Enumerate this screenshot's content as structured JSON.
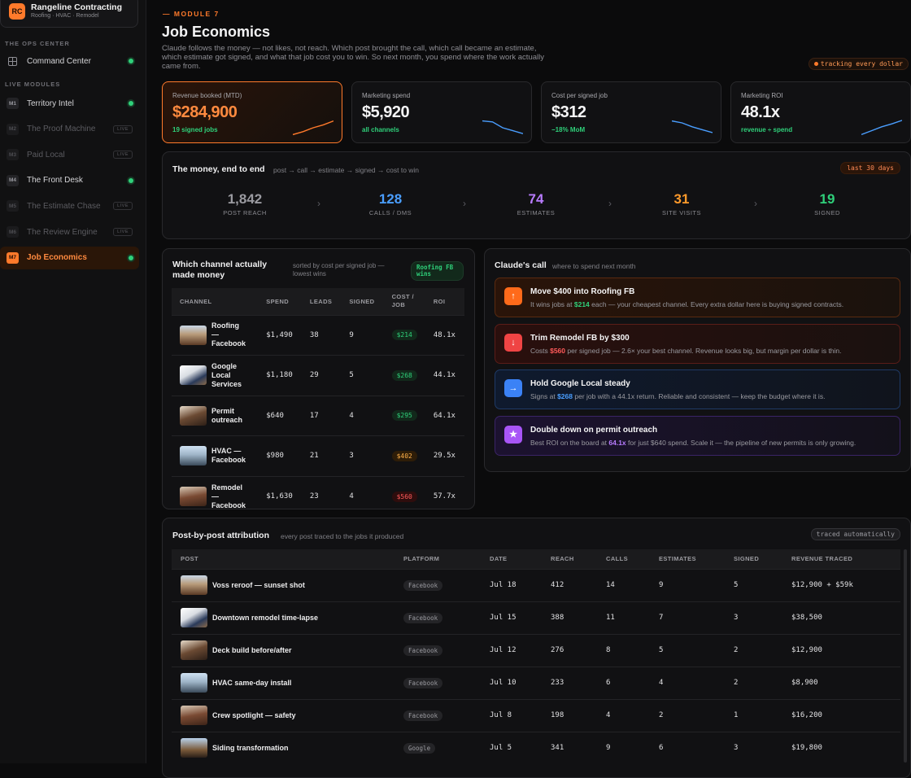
{
  "brand": {
    "badge": "RC",
    "name": "Rangeline Contracting",
    "sub": "Roofing · HVAC · Remodel"
  },
  "sidebar": {
    "ops_label": "THE OPS CENTER",
    "command_center": "Command Center",
    "live_label": "LIVE MODULES",
    "items": [
      {
        "num": "M1",
        "label": "Territory Intel",
        "state": "dot"
      },
      {
        "num": "M2",
        "label": "The Proof Machine",
        "state": "live",
        "tag": "LIVE"
      },
      {
        "num": "M3",
        "label": "Paid Local",
        "state": "live",
        "tag": "LIVE"
      },
      {
        "num": "M4",
        "label": "The Front Desk",
        "state": "dot"
      },
      {
        "num": "M5",
        "label": "The Estimate Chase",
        "state": "live",
        "tag": "LIVE"
      },
      {
        "num": "M6",
        "label": "The Review Engine",
        "state": "live",
        "tag": "LIVE"
      },
      {
        "num": "M7",
        "label": "Job Economics",
        "state": "active"
      }
    ]
  },
  "header": {
    "kicker": "— MODULE 7",
    "title": "Job Economics",
    "lede": "Claude follows the money — not likes, not reach. Which post brought the call, which call became an estimate, which estimate got signed, and what that job cost you to win. So next month, you spend where the work actually came from.",
    "tracking": "tracking every dollar"
  },
  "kpis": [
    {
      "label": "Revenue booked (MTD)",
      "value": "$284,900",
      "sub": "19 signed jobs",
      "trend": [
        0.15,
        0.3,
        0.5,
        0.65,
        0.85
      ],
      "color": "#ff7a2b"
    },
    {
      "label": "Marketing spend",
      "value": "$5,920",
      "sub": "all channels",
      "trend": [
        0.85,
        0.8,
        0.5,
        0.35,
        0.2
      ],
      "color": "#4a9eff"
    },
    {
      "label": "Cost per signed job",
      "value": "$312",
      "sub": "−18% MoM",
      "trend": [
        0.85,
        0.75,
        0.55,
        0.4,
        0.25
      ],
      "color": "#4a9eff"
    },
    {
      "label": "Marketing ROI",
      "value": "48.1x",
      "sub": "revenue ÷ spend",
      "trend": [
        0.15,
        0.35,
        0.55,
        0.7,
        0.88
      ],
      "color": "#4a9eff"
    }
  ],
  "funnel": {
    "title": "The money, end to end",
    "sub": "post → call → estimate → signed → cost to win",
    "range": "last 30 days",
    "steps": [
      {
        "value": "1,842",
        "label": "POST REACH",
        "color": "#9a9aa0"
      },
      {
        "value": "128",
        "label": "CALLS / DMS",
        "color": "#4a9eff"
      },
      {
        "value": "74",
        "label": "ESTIMATES",
        "color": "#b87cff"
      },
      {
        "value": "31",
        "label": "SITE VISITS",
        "color": "#ff9a2b"
      },
      {
        "value": "19",
        "label": "SIGNED",
        "color": "#2fd07a"
      }
    ]
  },
  "channels": {
    "title": "Which channel actually made money",
    "sub": "sorted by cost per signed job — lowest wins",
    "winner": "Roofing FB wins",
    "headers": [
      "CHANNEL",
      "SPEND",
      "LEADS",
      "SIGNED",
      "COST / JOB",
      "ROI"
    ],
    "rows": [
      {
        "name": "Roofing — Facebook",
        "spend": "$1,490",
        "leads": "38",
        "signed": "9",
        "cost": "$214",
        "tone": "g",
        "roi": "48.1x"
      },
      {
        "name": "Google Local Services",
        "spend": "$1,180",
        "leads": "29",
        "signed": "5",
        "cost": "$268",
        "tone": "g",
        "roi": "44.1x"
      },
      {
        "name": "Permit outreach",
        "spend": "$640",
        "leads": "17",
        "signed": "4",
        "cost": "$295",
        "tone": "g",
        "roi": "64.1x"
      },
      {
        "name": "HVAC — Facebook",
        "spend": "$980",
        "leads": "21",
        "signed": "3",
        "cost": "$402",
        "tone": "a",
        "roi": "29.5x"
      },
      {
        "name": "Remodel — Facebook",
        "spend": "$1,630",
        "leads": "23",
        "signed": "4",
        "cost": "$560",
        "tone": "r",
        "roi": "57.7x"
      }
    ]
  },
  "claude": {
    "title": "Claude's call",
    "sub": "where to spend next month",
    "recs": [
      {
        "title": "Move $400 into Roofing FB",
        "pre": "It wins jobs at ",
        "hl": "$214",
        "post": " each — your cheapest channel. Every extra dollar here is buying signed contracts.",
        "tone": "g",
        "icon": "↑"
      },
      {
        "title": "Trim Remodel FB by $300",
        "pre": "Costs ",
        "hl": "$560",
        "post": " per signed job — 2.6× your best channel. Revenue looks big, but margin per dollar is thin.",
        "tone": "r",
        "icon": "↓"
      },
      {
        "title": "Hold Google Local steady",
        "pre": "Signs at ",
        "hl": "$268",
        "post": " per job with a 44.1x return. Reliable and consistent — keep the budget where it is.",
        "tone": "b",
        "icon": "→"
      },
      {
        "title": "Double down on permit outreach",
        "pre": "Best ROI on the board at ",
        "hl": "64.1x",
        "post": " for just $640 spend. Scale it — the pipeline of new permits is only growing.",
        "tone": "p",
        "icon": "★"
      }
    ]
  },
  "posts": {
    "title": "Post-by-post attribution",
    "sub": "every post traced to the jobs it produced",
    "traced": "traced automatically",
    "headers": [
      "POST",
      "PLATFORM",
      "DATE",
      "REACH",
      "CALLS",
      "ESTIMATES",
      "SIGNED",
      "REVENUE TRACED"
    ],
    "rows": [
      {
        "name": "Voss reroof — sunset shot",
        "platform": "Facebook",
        "date": "Jul 18",
        "reach": "412",
        "calls": "14",
        "est": "9",
        "signed": "5",
        "rev": "$12,900 + $59k"
      },
      {
        "name": "Downtown remodel time-lapse",
        "platform": "Facebook",
        "date": "Jul 15",
        "reach": "388",
        "calls": "11",
        "est": "7",
        "signed": "3",
        "rev": "$38,500"
      },
      {
        "name": "Deck build before/after",
        "platform": "Facebook",
        "date": "Jul 12",
        "reach": "276",
        "calls": "8",
        "est": "5",
        "signed": "2",
        "rev": "$12,900"
      },
      {
        "name": "HVAC same-day install",
        "platform": "Facebook",
        "date": "Jul 10",
        "reach": "233",
        "calls": "6",
        "est": "4",
        "signed": "2",
        "rev": "$8,900"
      },
      {
        "name": "Crew spotlight — safety",
        "platform": "Facebook",
        "date": "Jul 8",
        "reach": "198",
        "calls": "4",
        "est": "2",
        "signed": "1",
        "rev": "$16,200"
      },
      {
        "name": "Siding transformation",
        "platform": "Google",
        "date": "Jul 5",
        "reach": "341",
        "calls": "9",
        "est": "6",
        "signed": "3",
        "rev": "$19,800"
      }
    ]
  }
}
